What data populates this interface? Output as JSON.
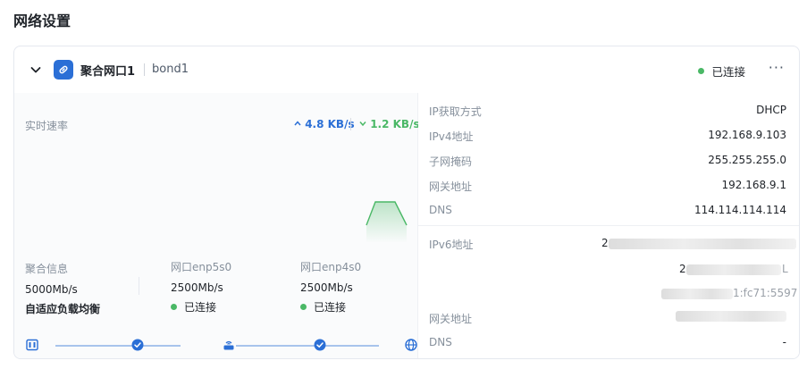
{
  "page": {
    "title": "网络设置"
  },
  "bond": {
    "title": "聚合网口1",
    "name": "bond1",
    "status": "已连接",
    "more_label": "···"
  },
  "speed": {
    "label": "实时速率",
    "upload": "4.8 KB/s",
    "download": "1.2 KB/s"
  },
  "aggregate": {
    "label": "聚合信息",
    "speed": "5000Mb/s",
    "mode": "自适应负载均衡"
  },
  "ports": [
    {
      "label": "网口enp5s0",
      "speed": "2500Mb/s",
      "status": "已连接"
    },
    {
      "label": "网口enp4s0",
      "speed": "2500Mb/s",
      "status": "已连接"
    }
  ],
  "ipv4": {
    "method_label": "IP获取方式",
    "method": "DHCP",
    "addr_label": "IPv4地址",
    "addr": "192.168.9.103",
    "mask_label": "子网掩码",
    "mask": "255.255.255.0",
    "gw_label": "网关地址",
    "gw": "192.168.9.1",
    "dns_label": "DNS",
    "dns": "114.114.114.114"
  },
  "ipv6": {
    "addr_label": "IPv6地址",
    "addr_partial_1": "2",
    "addr_partial_2": "2",
    "addr_partial_3": "L",
    "addr_partial_4": "1:fc71:5597",
    "gw_label": "网关地址",
    "dns_label": "DNS",
    "dns": "-"
  },
  "colors": {
    "accent": "#2b6fd6",
    "success": "#4ab866",
    "upload": "#2b6fd6",
    "download": "#4ab866"
  },
  "icons": {
    "collapse": "chevron-down-icon",
    "bond": "link-icon",
    "upload": "arrow-up-icon",
    "download": "arrow-down-icon",
    "nas": "device-icon",
    "router": "router-icon",
    "internet": "globe-icon",
    "link_ok": "check-circle-icon"
  }
}
